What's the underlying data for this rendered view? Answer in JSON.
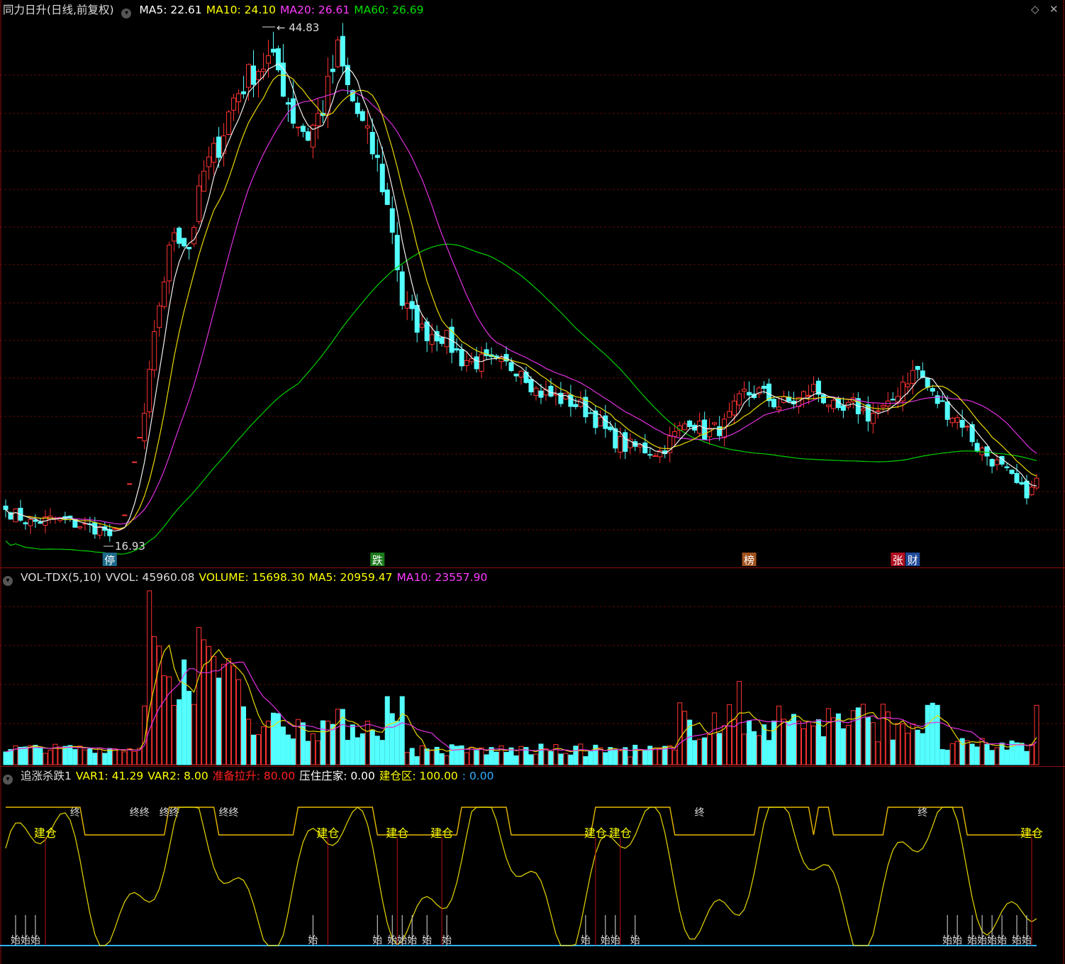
{
  "price_panel": {
    "title": "同力日升(日线,前复权)",
    "ma_labels": [
      {
        "text": "MA5: 22.61",
        "color": "#ffffff"
      },
      {
        "text": "MA10: 24.10",
        "color": "#ffff00"
      },
      {
        "text": "MA20: 26.61",
        "color": "#ff3cff"
      },
      {
        "text": "MA60: 26.69",
        "color": "#00e000"
      }
    ],
    "high_label": "44.83",
    "low_label": "16.93",
    "markers": [
      {
        "text": "停",
        "bg": "#1d6a8a",
        "idx": 21
      },
      {
        "text": "跌",
        "bg": "#1b7a1b",
        "idx": 75
      },
      {
        "text": "榜",
        "bg": "#a0521d",
        "idx": 150
      },
      {
        "text": "张",
        "bg": "#b01020",
        "idx": 180
      },
      {
        "text": "财",
        "bg": "#1f4a9a",
        "idx": 183
      }
    ]
  },
  "volume_panel": {
    "labels": [
      {
        "text": "VOL-TDX(5,10)",
        "color": "#dddddd"
      },
      {
        "text": "VVOL: 45960.08",
        "color": "#dddddd"
      },
      {
        "text": "VOLUME: 15698.30",
        "color": "#ffff00"
      },
      {
        "text": "MA5: 20959.47",
        "color": "#ffff00"
      },
      {
        "text": "MA10: 23557.90",
        "color": "#ff3cff"
      }
    ]
  },
  "indicator_panel": {
    "labels": [
      {
        "text": "追涨杀跌1",
        "color": "#dddddd"
      },
      {
        "text": "VAR1: 41.29",
        "color": "#ffff00"
      },
      {
        "text": "VAR2: 8.00",
        "color": "#ffff00"
      },
      {
        "text": "准备拉升: 80.00",
        "color": "#ff2020"
      },
      {
        "text": "压住庄家: 0.00",
        "color": "#ffffff"
      },
      {
        "text": "建仓区: 100.00",
        "color": "#ffff00"
      },
      {
        "text": ": 0.00",
        "color": "#30b0ff"
      }
    ],
    "build_label": "建仓",
    "start_label": "始",
    "end_label": "终"
  },
  "chart_data": {
    "type": "candlestick",
    "title": "同力日升(日线,前复权)",
    "bars": 209,
    "price_range": [
      16.93,
      44.83
    ],
    "last_ma": {
      "MA5": 22.61,
      "MA10": 24.1,
      "MA20": 26.61,
      "MA60": 26.69
    },
    "anchors": [
      [
        0,
        18.9
      ],
      [
        5,
        18.2
      ],
      [
        10,
        18.4
      ],
      [
        16,
        18.0
      ],
      [
        20,
        17.8
      ],
      [
        21,
        17.2
      ],
      [
        24,
        18.6
      ],
      [
        28,
        24.0
      ],
      [
        31,
        30.0
      ],
      [
        34,
        34.0
      ],
      [
        37,
        33.0
      ],
      [
        40,
        37.0
      ],
      [
        43,
        38.5
      ],
      [
        46,
        41.0
      ],
      [
        50,
        42.5
      ],
      [
        53,
        43.0
      ],
      [
        55,
        42.5
      ],
      [
        58,
        40.0
      ],
      [
        61,
        39.0
      ],
      [
        64,
        40.5
      ],
      [
        67,
        43.5
      ],
      [
        69,
        41.5
      ],
      [
        72,
        39.5
      ],
      [
        75,
        37.5
      ],
      [
        78,
        34.0
      ],
      [
        80,
        30.0
      ],
      [
        84,
        28.5
      ],
      [
        88,
        28.3
      ],
      [
        92,
        27.0
      ],
      [
        96,
        26.8
      ],
      [
        100,
        26.6
      ],
      [
        104,
        26.6
      ],
      [
        107,
        25.3
      ],
      [
        110,
        25.0
      ],
      [
        114,
        24.7
      ],
      [
        118,
        24.1
      ],
      [
        122,
        22.8
      ],
      [
        125,
        22.3
      ],
      [
        128,
        22.2
      ],
      [
        132,
        22.0
      ],
      [
        135,
        22.9
      ],
      [
        138,
        23.8
      ],
      [
        141,
        23.0
      ],
      [
        145,
        23.4
      ],
      [
        149,
        25.1
      ],
      [
        152,
        25.2
      ],
      [
        156,
        24.5
      ],
      [
        160,
        24.8
      ],
      [
        163,
        25.4
      ],
      [
        166,
        24.7
      ],
      [
        168,
        23.9
      ],
      [
        171,
        24.5
      ],
      [
        174,
        24.0
      ],
      [
        178,
        24.3
      ],
      [
        181,
        25.8
      ],
      [
        184,
        26.4
      ],
      [
        187,
        25.0
      ],
      [
        190,
        24.2
      ],
      [
        193,
        23.6
      ],
      [
        196,
        22.3
      ],
      [
        199,
        21.6
      ],
      [
        202,
        20.8
      ],
      [
        205,
        19.9
      ],
      [
        207,
        19.9
      ],
      [
        208,
        20.5
      ]
    ],
    "volume_last": 15698.3,
    "volume_ma5": 20959.47,
    "volume_ma10": 23557.9,
    "vvol": 45960.08,
    "indicator": {
      "VAR1": 41.29,
      "VAR2": 8.0,
      "准备拉升": 80.0,
      "压住庄家": 0.0,
      "建仓区": 100.0,
      "value": 0.0
    }
  }
}
